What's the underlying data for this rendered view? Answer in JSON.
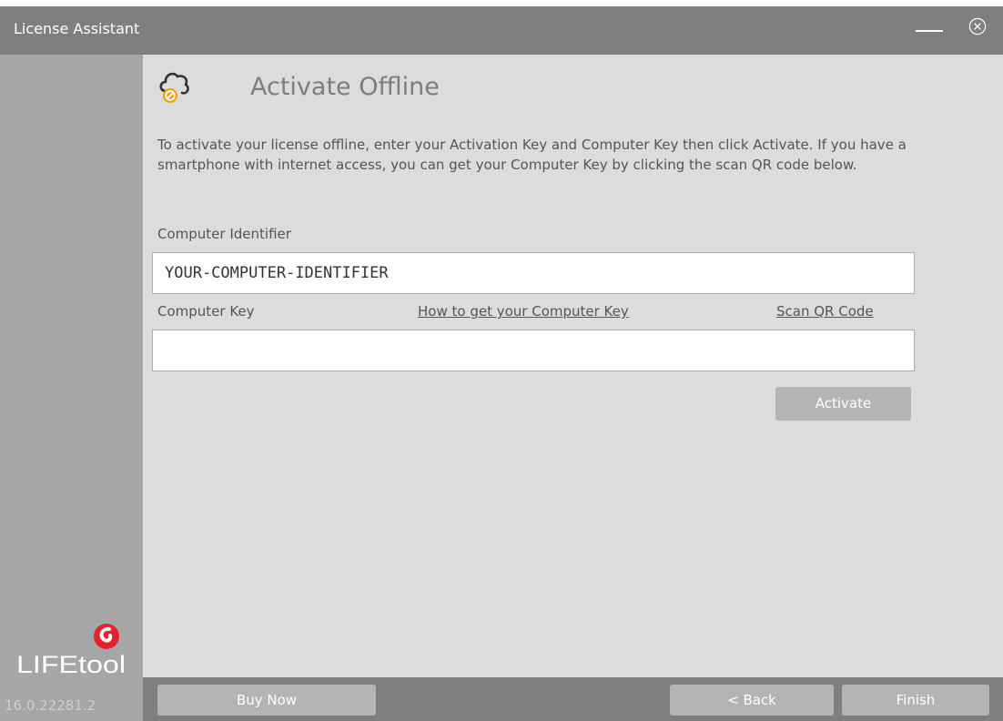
{
  "window": {
    "title": "License Assistant"
  },
  "sidebar": {
    "version": "16.0.22281.2",
    "logo_text": "LIFEtool"
  },
  "page": {
    "heading": "Activate Offline",
    "description": "To activate your license offline, enter your Activation Key and Computer Key then click Activate. If you have a smartphone with internet access, you can get your Computer Key by clicking the scan QR code below."
  },
  "form": {
    "computer_identifier_label": "Computer Identifier",
    "computer_identifier_value": "YOUR-COMPUTER-IDENTIFIER",
    "computer_key_label": "Computer Key",
    "how_to_link": "How to get your Computer Key",
    "scan_qr_link": "Scan QR Code",
    "computer_key_value": "",
    "activate_label": "Activate"
  },
  "footer": {
    "buy_now_label": "Buy Now",
    "back_label": "< Back",
    "finish_label": "Finish"
  },
  "colors": {
    "titlebar": "#7f7f7f",
    "sidebar": "#a6a6a6",
    "content_bg": "#dcdcdc",
    "icon_accent": "#f0a30a",
    "logo_red": "#e5212b"
  }
}
